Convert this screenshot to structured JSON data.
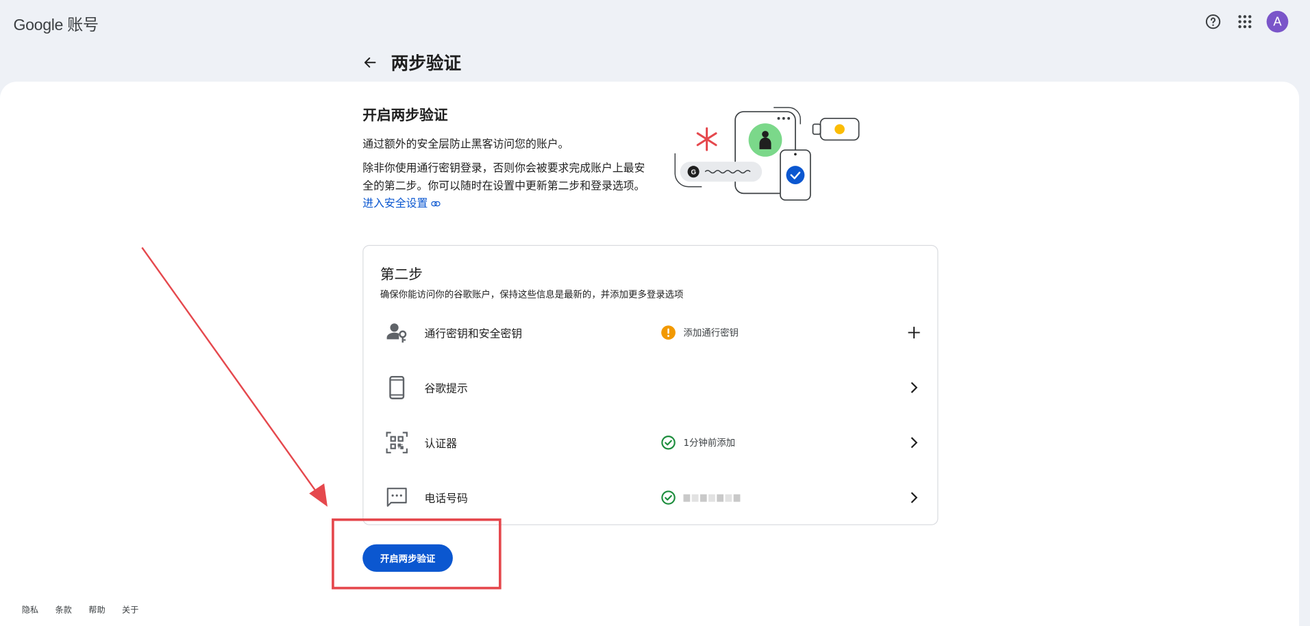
{
  "app": {
    "brand": "Google",
    "product": "账号"
  },
  "header": {
    "title": "两步验证",
    "back_icon": "arrow-back-icon"
  },
  "topbar": {
    "help_icon": "help-circle-icon",
    "apps_icon": "apps-grid-icon",
    "avatar_letter": "A",
    "avatar_color": "#7a55c9"
  },
  "intro": {
    "heading": "开启两步验证",
    "p1": "通过额外的安全层防止黑客访问您的账户。",
    "p2": "除非你使用通行密钥登录，否则你会被要求完成账户上最安全的第二步。你可以随时在设置中更新第二步和登录选项。",
    "link": "进入安全设置"
  },
  "second_step": {
    "title": "第二步",
    "subtitle": "确保你能访问你的谷歌账户，保持这些信息是最新的，并添加更多登录选项",
    "items": [
      {
        "label": "通行密钥和安全密钥",
        "status": "添加通行密钥",
        "status_type": "warning",
        "action": "add",
        "icon": "person-key-icon"
      },
      {
        "label": "谷歌提示",
        "status": "",
        "status_type": "none",
        "action": "open",
        "icon": "phone-icon"
      },
      {
        "label": "认证器",
        "status": "1分钟前添加",
        "status_type": "ok",
        "action": "open",
        "icon": "qr-scan-icon"
      },
      {
        "label": "电话号码",
        "status": "",
        "status_type": "ok-redacted",
        "action": "open",
        "icon": "sms-icon"
      }
    ]
  },
  "cta": {
    "label": "开启两步验证"
  },
  "footer": {
    "links": [
      "隐私",
      "条款",
      "帮助",
      "关于"
    ]
  },
  "colors": {
    "accent": "#0b57d0",
    "warning": "#f29900",
    "ok": "#1e8e3e",
    "annotation": "#e5484d"
  }
}
